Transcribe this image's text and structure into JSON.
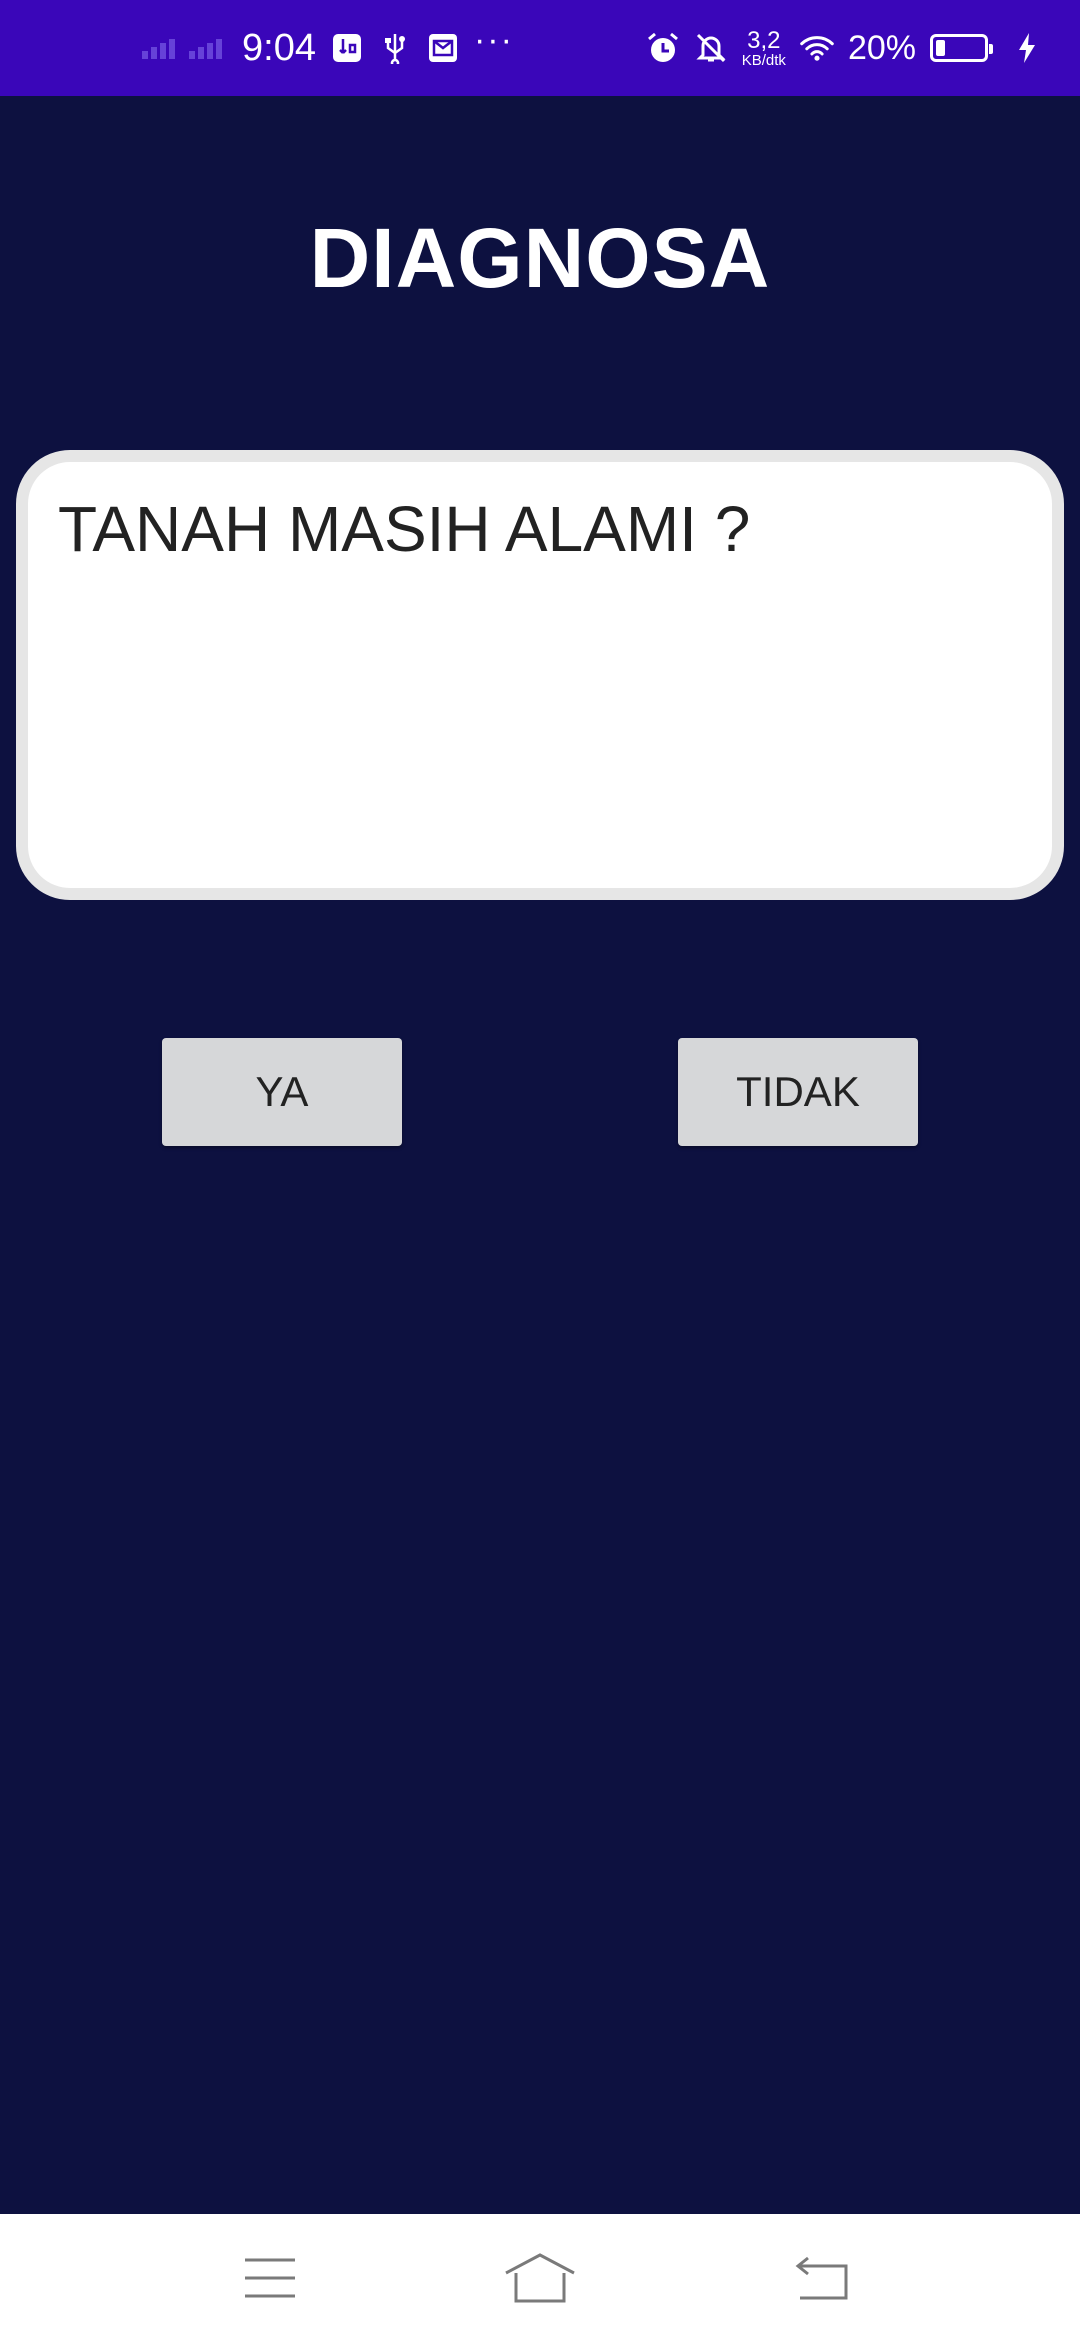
{
  "status_bar": {
    "time": "9:04",
    "more_dots": "···",
    "speed_value": "3,2",
    "speed_unit": "KB/dtk",
    "battery_percent": "20%",
    "battery_level": 0.2,
    "icons": [
      "signal-icon",
      "signal-icon",
      "usb-debug-icon",
      "usb-icon",
      "mail-icon",
      "more-icon",
      "alarm-icon",
      "notifications-off-icon",
      "wifi-icon",
      "battery-icon",
      "charging-icon"
    ]
  },
  "header": {
    "title": "DIAGNOSA"
  },
  "question": {
    "text": "TANAH MASIH ALAMI ?"
  },
  "answers": {
    "yes_label": "YA",
    "no_label": "TIDAK"
  },
  "nav_bar": {
    "icons": [
      "menu-icon",
      "home-icon",
      "back-icon"
    ]
  },
  "colors": {
    "status_bar": "#3a06b9",
    "background": "#0d1140",
    "card": "#ffffff",
    "card_border": "#e6e6e6",
    "button": "#d6d7d9"
  }
}
